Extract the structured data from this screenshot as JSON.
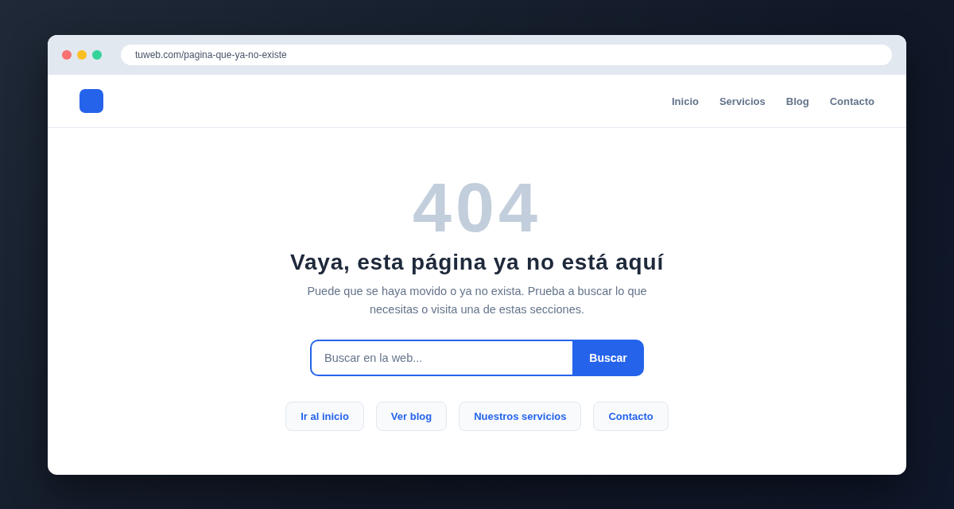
{
  "browser": {
    "window_dots": [
      {
        "color": "#f87171"
      },
      {
        "color": "#fbbf24"
      },
      {
        "color": "#34d399"
      }
    ],
    "url": "tuweb.com/pagina-que-ya-no-existe"
  },
  "header": {
    "nav": [
      {
        "label": "Inicio"
      },
      {
        "label": "Servicios"
      },
      {
        "label": "Blog"
      },
      {
        "label": "Contacto"
      }
    ]
  },
  "error": {
    "code": "404",
    "title": "Vaya, esta página ya no está aquí",
    "message": "Puede que se haya movido o ya no exista. Prueba a buscar lo que necesitas o visita una de estas secciones."
  },
  "search": {
    "placeholder": "Buscar en la web...",
    "button": "Buscar"
  },
  "quick_links": [
    {
      "label": "Ir al inicio"
    },
    {
      "label": "Ver blog"
    },
    {
      "label": "Nuestros servicios"
    },
    {
      "label": "Contacto"
    }
  ]
}
